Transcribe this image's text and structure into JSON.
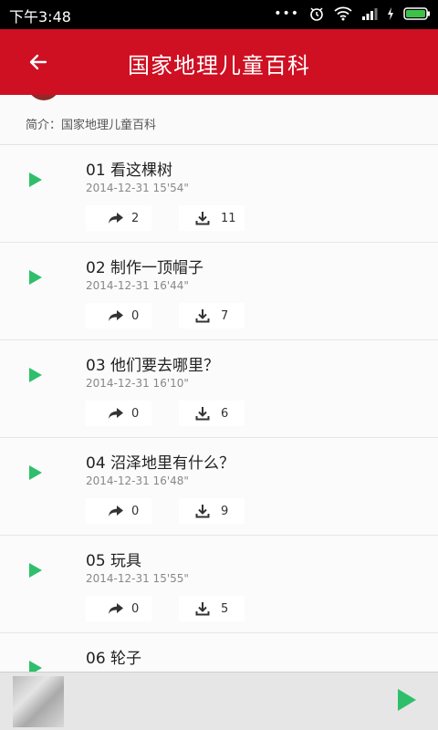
{
  "status_bar": {
    "time": "下午3:48"
  },
  "app_bar": {
    "title": "国家地理儿童百科"
  },
  "intro": {
    "text": "简介：国家地理儿童百科"
  },
  "episodes": [
    {
      "title": "01 看这棵树",
      "date": "2014-12-31  15'54\"",
      "shares": "2",
      "downloads": "11"
    },
    {
      "title": "02 制作一顶帽子",
      "date": "2014-12-31  16'44\"",
      "shares": "0",
      "downloads": "7"
    },
    {
      "title": "03 他们要去哪里？",
      "date": "2014-12-31  16'10\"",
      "shares": "0",
      "downloads": "6"
    },
    {
      "title": "04 沼泽地里有什么？",
      "date": "2014-12-31  16'48\"",
      "shares": "0",
      "downloads": "9"
    },
    {
      "title": "05 玩具",
      "date": "2014-12-31  15'55\"",
      "shares": "0",
      "downloads": "5"
    },
    {
      "title": "06 轮子",
      "date": "",
      "shares": "",
      "downloads": ""
    }
  ],
  "colors": {
    "brand": "#cf0f22",
    "play_green": "#2fbf6b"
  },
  "icons": [
    "arrow-back-icon",
    "play-icon",
    "share-icon",
    "download-icon",
    "wifi-icon",
    "signal-icon",
    "battery-icon",
    "alarm-icon"
  ]
}
